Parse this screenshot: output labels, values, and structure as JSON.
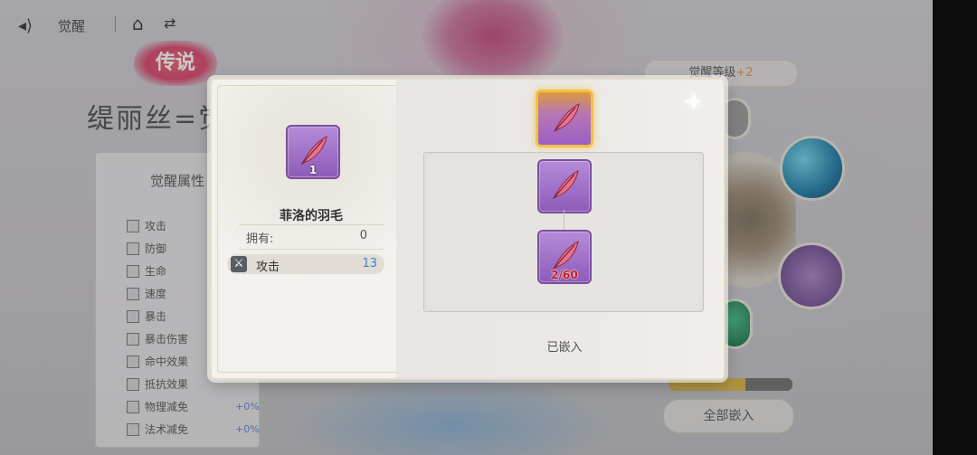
{
  "topbar": {
    "back_icon": "back-arrow-icon",
    "title": "觉醒",
    "home_icon": "home-icon",
    "switch_icon": "switch-icon"
  },
  "background": {
    "logo_text": "传说",
    "big_title": "缇丽丝=觉",
    "stat_panel_header": "觉醒属性",
    "stats": [
      {
        "label": "攻击",
        "value": ""
      },
      {
        "label": "防御",
        "value": ""
      },
      {
        "label": "生命",
        "value": ""
      },
      {
        "label": "速度",
        "value": ""
      },
      {
        "label": "暴击",
        "value": ""
      },
      {
        "label": "暴击伤害",
        "value": ""
      },
      {
        "label": "命中效果",
        "value": ""
      },
      {
        "label": "抵抗效果",
        "value": ""
      },
      {
        "label": "物理减免",
        "value": "+0%"
      },
      {
        "label": "法术减免",
        "value": "+0%"
      }
    ],
    "level_label": "觉醒等级",
    "level_value": "+2",
    "embed_all_button": "全部嵌入",
    "progress": 0.62,
    "accent_color": "#e29a2a"
  },
  "modal": {
    "selected_item": {
      "qty": "1",
      "icon": "feather-icon"
    },
    "item_name": "菲洛的羽毛",
    "own_label": "拥有:",
    "own_value": "0",
    "attribute": {
      "icon": "sword-icon",
      "label": "攻击",
      "value": "13"
    },
    "top_slot": {
      "icon": "feather-icon"
    },
    "slots": [
      {
        "icon": "feather-icon",
        "qty": ""
      },
      {
        "icon": "feather-icon",
        "qty": "2/60"
      }
    ],
    "embedded_label": "已嵌入",
    "colors": {
      "tile_purple": "#9a67c2",
      "selected_gold": "#f2c146",
      "value_blue": "#3f7fc6",
      "insufficient_red": "#c81a1a"
    }
  }
}
